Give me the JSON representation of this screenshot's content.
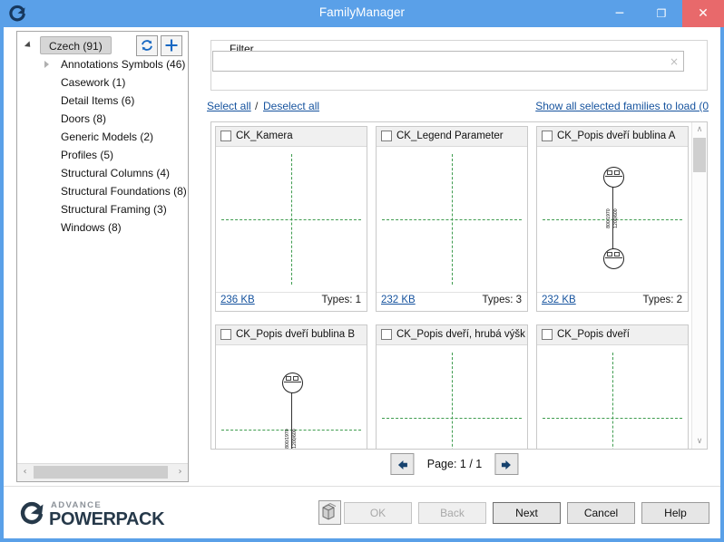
{
  "window": {
    "title": "FamilyManager",
    "app_icon": "advance-logo-icon",
    "minimize": "minimize-icon",
    "maximize": "maximize-icon",
    "close": "close-icon",
    "close_glyph": "✕",
    "minimize_glyph": "─",
    "maximize_glyph": "❐",
    "titlebar_color": "#5aa0e8",
    "close_color": "#e8696b"
  },
  "tree": {
    "root": {
      "label": "Czech (91)",
      "expanded": true
    },
    "refresh_icon": "refresh-icon",
    "add_icon": "plus-icon",
    "items": [
      {
        "label": "Annotations Symbols (46)",
        "has_children": true
      },
      {
        "label": "Casework (1)",
        "has_children": false
      },
      {
        "label": "Detail Items (6)",
        "has_children": false
      },
      {
        "label": "Doors (8)",
        "has_children": false
      },
      {
        "label": "Generic Models (2)",
        "has_children": false
      },
      {
        "label": "Profiles (5)",
        "has_children": false
      },
      {
        "label": "Structural Columns (4)",
        "has_children": false
      },
      {
        "label": "Structural Foundations (8)",
        "has_children": false
      },
      {
        "label": "Structural Framing (3)",
        "has_children": false
      },
      {
        "label": "Windows (8)",
        "has_children": false
      }
    ],
    "hscroll_left": "‹",
    "hscroll_right": "›"
  },
  "filter": {
    "legend": "Filter",
    "value": "",
    "placeholder": "",
    "clear_glyph": "×"
  },
  "links": {
    "select_all": "Select all",
    "separator": "/",
    "deselect_all": "Deselect all",
    "show_selected": "Show all selected families to load (0",
    "link_color": "#16539e"
  },
  "gallery": {
    "scroll_up_glyph": "∧",
    "scroll_down_glyph": "∨",
    "cards": [
      {
        "title": "CK_Kamera",
        "checked": false,
        "size": "236 KB",
        "types": "Types: 1",
        "preview": "crosshair"
      },
      {
        "title": "CK_Legend Parameter",
        "checked": false,
        "size": "232 KB",
        "types": "Types: 3",
        "preview": "crosshair"
      },
      {
        "title": "CK_Popis dveří bublina A",
        "checked": false,
        "size": "232 KB",
        "types": "Types: 2",
        "preview": "two-bubbles"
      },
      {
        "title": "CK_Popis dveří bublina B",
        "checked": false,
        "size": "",
        "types": "",
        "preview": "one-bubble"
      },
      {
        "title": "CK_Popis dveří, hrubá výška",
        "checked": false,
        "size": "",
        "types": "",
        "preview": "crosshair"
      },
      {
        "title": "CK_Popis dveří",
        "checked": false,
        "size": "",
        "types": "",
        "preview": "crosshair"
      }
    ]
  },
  "pager": {
    "prev_icon": "arrow-left-icon",
    "next_icon": "arrow-right-icon",
    "label": "Page: 1 / 1"
  },
  "footer": {
    "logo_mark": "G",
    "logo_top": "ADVANCE",
    "logo_bottom": "POWERPACK",
    "stack_icon": "stacked-blocks-icon",
    "buttons": [
      {
        "label": "OK",
        "disabled": true,
        "name": "ok-button"
      },
      {
        "label": "Back",
        "disabled": true,
        "name": "back-button"
      },
      {
        "label": "Next",
        "disabled": false,
        "name": "next-button"
      },
      {
        "label": "Cancel",
        "disabled": false,
        "name": "cancel-button"
      },
      {
        "label": "Help",
        "disabled": false,
        "name": "help-button"
      }
    ]
  }
}
